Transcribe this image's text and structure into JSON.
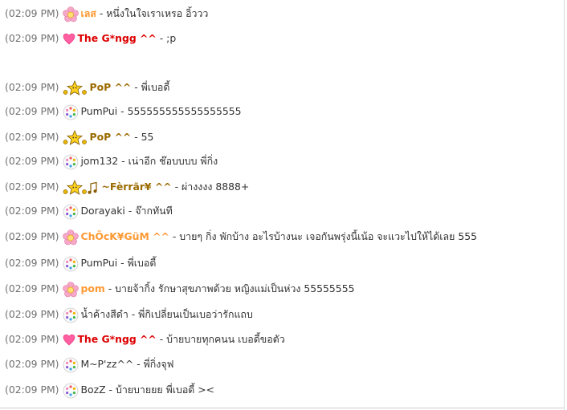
{
  "chat": {
    "messages": [
      {
        "time": "(02:09 PM)",
        "icon": "pink-flower-icon",
        "name": "เลส",
        "name_color": "#ff9933",
        "bold": true,
        "separator": "-",
        "text": "หนึ่งในใจเราเหรอ อิ้ววว"
      },
      {
        "time": "(02:09 PM)",
        "icon": "pink-heart-icon",
        "name": "The G*ngg ^^",
        "name_color": "#dd0000",
        "bold": true,
        "separator": "-",
        "text": ";p"
      },
      {
        "time": "(02:09 PM)",
        "icon": "star-friends-icon",
        "name": "PoP ^^",
        "name_color": "#9a6a00",
        "bold": true,
        "separator": "-",
        "text": "พี่เบอดี้"
      },
      {
        "time": "(02:09 PM)",
        "icon": "default-user-icon",
        "name": "PumPui",
        "name_color": "#333333",
        "bold": false,
        "separator": "-",
        "text": "555555555555555555"
      },
      {
        "time": "(02:09 PM)",
        "icon": "star-friends-icon",
        "name": "PoP ^^",
        "name_color": "#9a6a00",
        "bold": true,
        "separator": "-",
        "text": "55"
      },
      {
        "time": "(02:09 PM)",
        "icon": "default-user-icon",
        "name": "jom132",
        "name_color": "#333333",
        "bold": false,
        "separator": "-",
        "text": "เน่าอีก ช๊อบบบบ พี่กิ่ง"
      },
      {
        "time": "(02:09 PM)",
        "icon": "star-music-icon",
        "name": "~Fèrrãr¥ ^^",
        "name_color": "#9a6a00",
        "bold": true,
        "separator": "-",
        "text": "ผ่างงงง 8888+"
      },
      {
        "time": "(02:09 PM)",
        "icon": "default-user-icon",
        "name": "Dorayaki",
        "name_color": "#333333",
        "bold": false,
        "separator": "-",
        "text": "จ๊ากทันที"
      },
      {
        "time": "(02:09 PM)",
        "icon": "pink-flower-icon",
        "name": "ChÕcK¥GüM ^^",
        "name_color": "#ff9933",
        "bold": true,
        "separator": "-",
        "text": "บายๆ กิ่ง พักบ้าง อะไรบ้างนะ เจอกันพรุ่งนี้เน้อ จะแวะไปให้ได้เลย 555"
      },
      {
        "time": "(02:09 PM)",
        "icon": "default-user-icon",
        "name": "PumPui",
        "name_color": "#333333",
        "bold": false,
        "separator": "-",
        "text": "พี่เบอดี้"
      },
      {
        "time": "(02:09 PM)",
        "icon": "pink-flower-icon",
        "name": "pom",
        "name_color": "#ff9933",
        "bold": true,
        "separator": "-",
        "text": "บายจ้ากิ้ง รักษาสุขภาพด้วย หญิงแม่เป็นห่วง 55555555"
      },
      {
        "time": "(02:09 PM)",
        "icon": "default-user-icon",
        "name": "น้ำค้างสีดำ",
        "name_color": "#333333",
        "bold": false,
        "separator": "-",
        "text": "พี่กิเปลี่ยนเป็นเบอว่ารักแถบ"
      },
      {
        "time": "(02:09 PM)",
        "icon": "pink-heart-icon",
        "name": "The G*ngg ^^",
        "name_color": "#dd0000",
        "bold": true,
        "separator": "-",
        "text": "บ้ายบายทุกคนน เบอดี้ขอตัว"
      },
      {
        "time": "(02:09 PM)",
        "icon": "default-user-icon",
        "name": "M~P'zz^^",
        "name_color": "#333333",
        "bold": false,
        "separator": "-",
        "text": "พี่กิ่งจุฟ"
      },
      {
        "time": "(02:09 PM)",
        "icon": "default-user-icon",
        "name": "BozZ",
        "name_color": "#333333",
        "bold": false,
        "separator": "-",
        "text": "บ้ายบายยย พี่เบอดี้ ><"
      }
    ]
  }
}
